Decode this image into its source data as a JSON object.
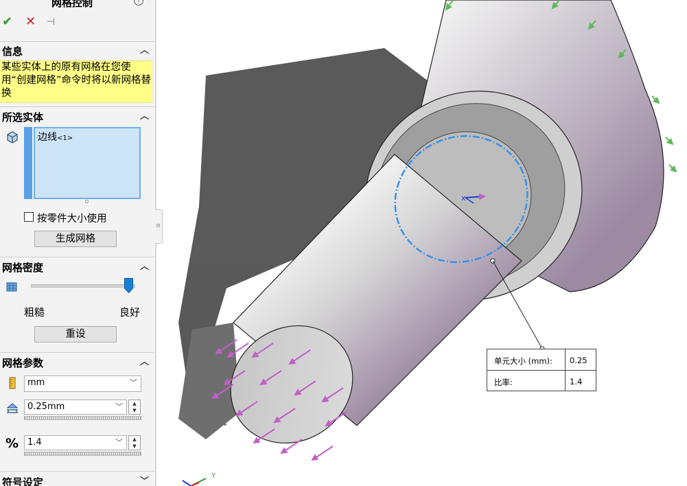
{
  "panel": {
    "title": "网格控制",
    "info_icon": "info-icon",
    "toolbar": {
      "ok": "✔",
      "cancel": "✕",
      "pin": "⊣"
    },
    "info_section": {
      "header": "信息",
      "message": "某些实体上的原有网格在您使用“创建网格”命令时将以新网格替换"
    },
    "selected_section": {
      "header": "所选实体",
      "item_text": "边线",
      "item_suffix": "<1>",
      "checkbox_label": "按零件大小使用",
      "checkbox_checked": false,
      "button": "生成网格"
    },
    "density_section": {
      "header": "网格密度",
      "coarse": "粗糙",
      "fine": "良好",
      "level": 1.0,
      "button": "重设"
    },
    "params_section": {
      "header": "网格参数",
      "unit": "mm",
      "element_size": "0.25mm",
      "ratio": "1.4"
    },
    "symbol_section": {
      "header": "符号设定"
    }
  },
  "callout": {
    "size_label": "单元大小 (mm):",
    "size_value": "0.25",
    "ratio_label": "比率:",
    "ratio_value": "1.4"
  },
  "triad": {
    "y_label": "Y"
  },
  "colors": {
    "selection_edge": "#3b8fe8",
    "load_arrows": "#c060c8",
    "fixture_arrows": "#5fb85f",
    "info_yellow": "#ffff88"
  }
}
